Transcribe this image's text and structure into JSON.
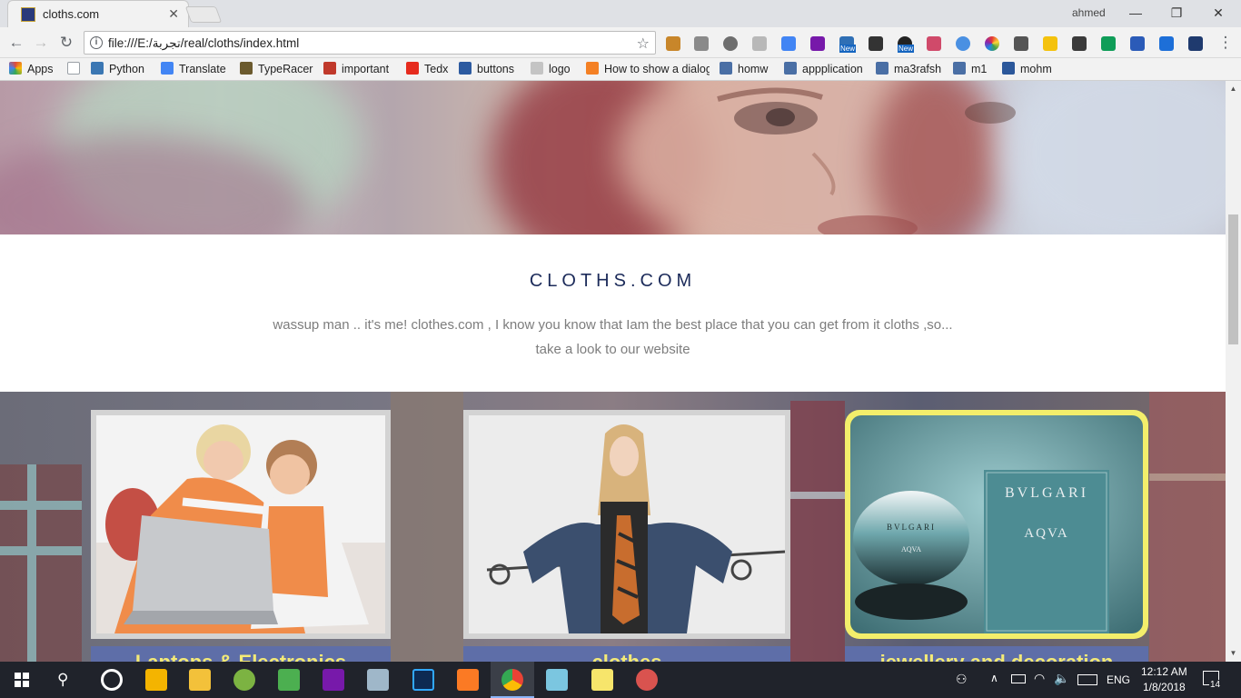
{
  "browser": {
    "tab_title": "cloths.com",
    "user_name": "ahmed",
    "url": "file:///E:/تجربة/real/cloths/index.html",
    "ext_new_1": "New",
    "ext_new_2": "New"
  },
  "bookmarks": [
    {
      "label": "Apps",
      "color": "#e04a3b"
    },
    {
      "label": "",
      "color": "#9aa0a6"
    },
    {
      "label": "Python",
      "color": "#3b77b3"
    },
    {
      "label": "Translate",
      "color": "#4285f4"
    },
    {
      "label": "TypeRacer",
      "color": "#6b5a2e"
    },
    {
      "label": "important",
      "color": "#c0392b"
    },
    {
      "label": "Tedx",
      "color": "#e62b1e"
    },
    {
      "label": "buttons",
      "color": "#2c5aa0"
    },
    {
      "label": "logo",
      "color": "#9e9e9e"
    },
    {
      "label": "How to show a dialog",
      "color": "#f48024"
    },
    {
      "label": "homw",
      "color": "#4a6fa5"
    },
    {
      "label": "appplication",
      "color": "#4a6fa5"
    },
    {
      "label": "ma3rafsh",
      "color": "#4a6fa5"
    },
    {
      "label": "m1",
      "color": "#4a6fa5"
    },
    {
      "label": "mohm",
      "color": "#2b579a"
    }
  ],
  "page": {
    "site_title": "CLOTHS.COM",
    "tagline_line1": "wassup man .. it's me! clothes.com , I know you know that Iam the best place that you can get from it cloths ,so...",
    "tagline_line2": "take a look to our website",
    "cards": [
      {
        "label": "Laptops & Electronics",
        "image": "mother-and-child-laptop"
      },
      {
        "label": "clothes",
        "image": "girl-with-denim-jacket"
      },
      {
        "label": "jewellery and decoration",
        "image": "bvlgari-aqva-perfume"
      }
    ]
  },
  "taskbar": {
    "language": "ENG",
    "time": "12:12 AM",
    "date": "1/8/2018",
    "notifications": "14"
  }
}
